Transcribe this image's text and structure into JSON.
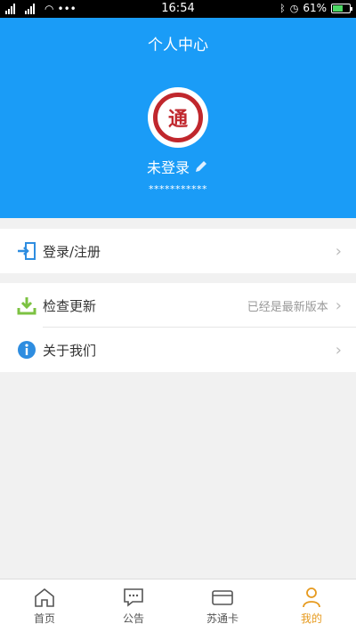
{
  "status_bar": {
    "left_text": "2G 4G",
    "time": "16:54",
    "battery": "61%",
    "battery_level": 0.61
  },
  "header": {
    "title": "个人中心",
    "username": "未登录",
    "masked": "***********",
    "avatar_char": "通"
  },
  "menu": {
    "login": {
      "label": "登录/注册"
    },
    "update": {
      "label": "检查更新",
      "note": "已经是最新版本"
    },
    "about": {
      "label": "关于我们"
    }
  },
  "tabs": [
    {
      "label": "首页",
      "icon": "home-icon"
    },
    {
      "label": "公告",
      "icon": "message-icon"
    },
    {
      "label": "苏通卡",
      "icon": "card-icon"
    },
    {
      "label": "我的",
      "icon": "user-icon",
      "active": true
    }
  ],
  "colors": {
    "primary": "#1a9cf7",
    "accent": "#e69a1e",
    "update_icon": "#7cc242",
    "info_icon": "#2e8de0"
  }
}
